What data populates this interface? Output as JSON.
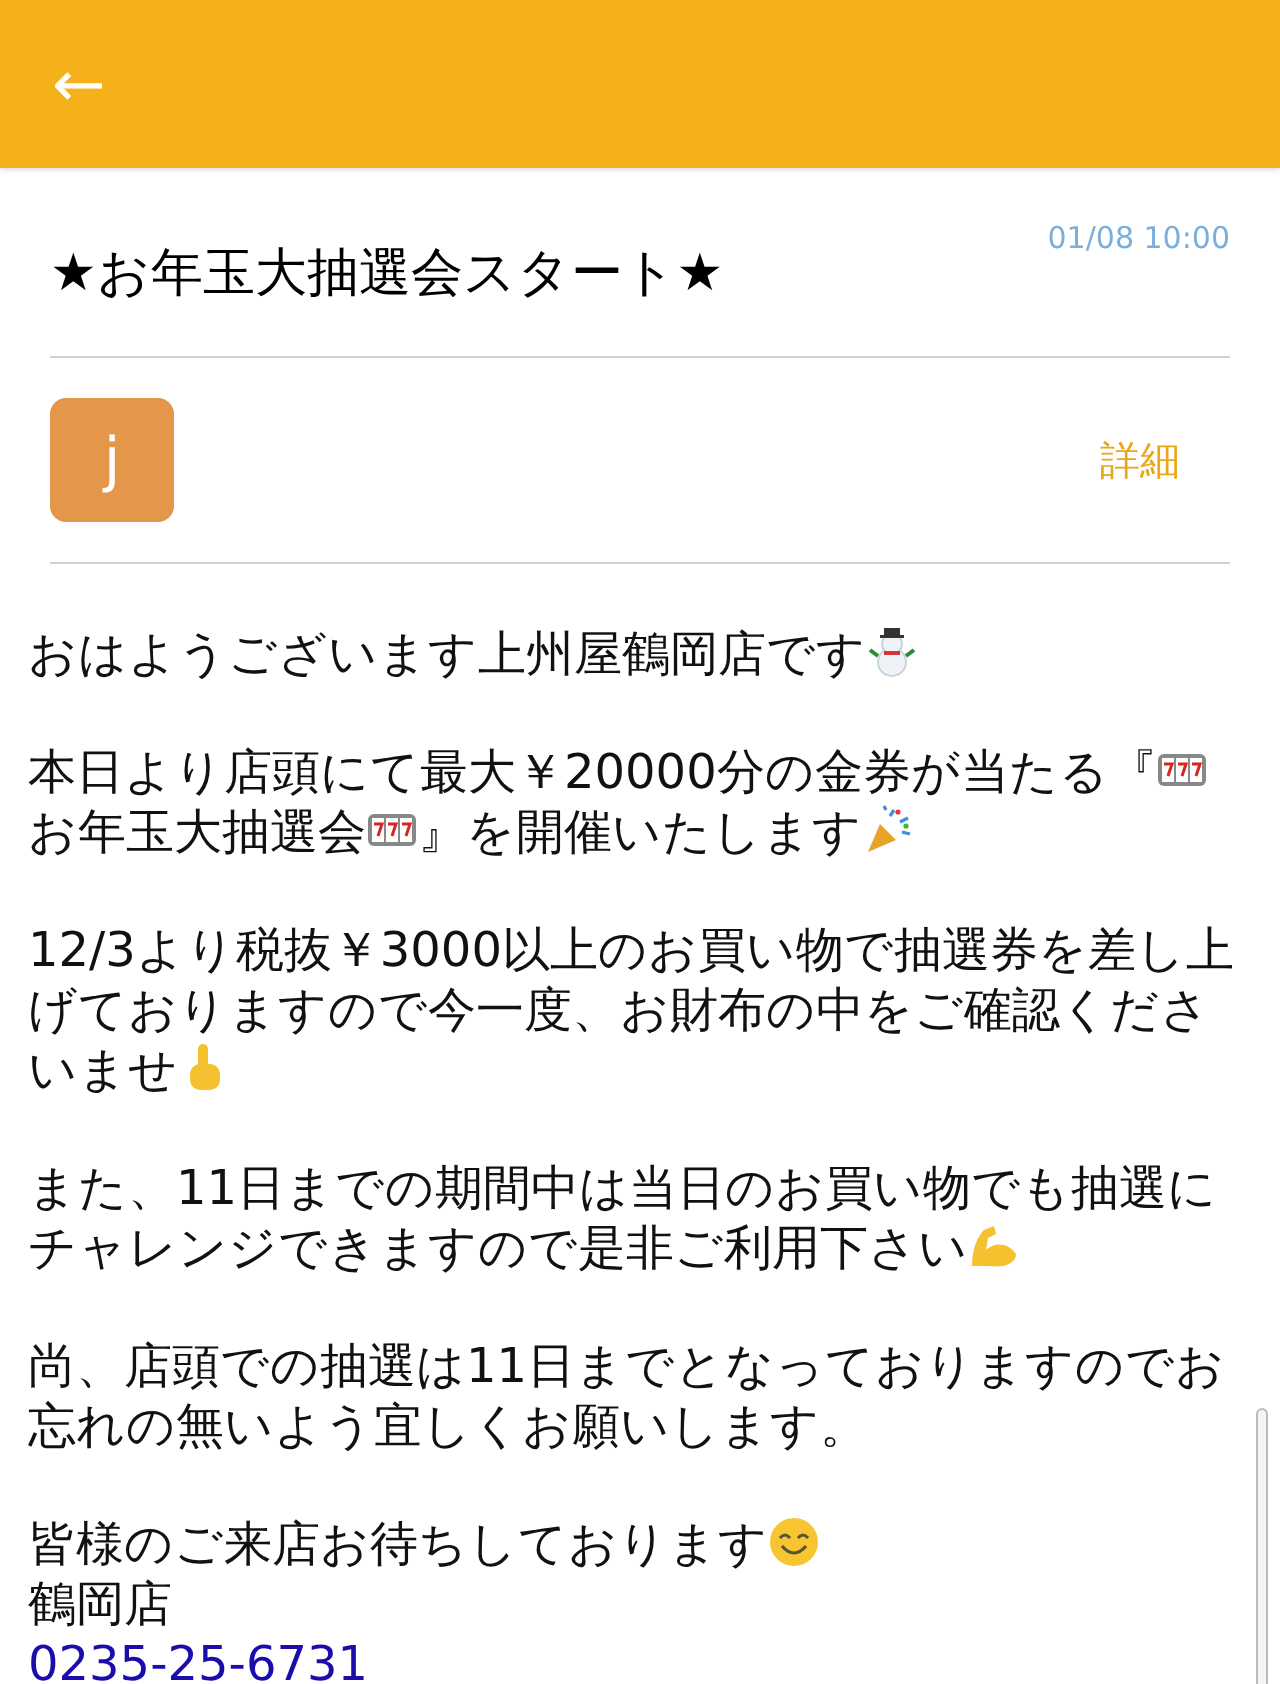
{
  "header": {
    "back": "←"
  },
  "message": {
    "title": "★お年玉大抽選会スタート★",
    "date": "01/08 10:00",
    "avatar": "j",
    "details": "詳細"
  },
  "body": [
    [
      [
        {
          "kind": "text",
          "text": "おはようございます上州屋鶴岡店です"
        },
        {
          "kind": "snowman"
        }
      ]
    ],
    [
      [
        {
          "kind": "text",
          "text": "本日より店頭にて最大￥20000分の金券が当たる『"
        },
        {
          "kind": "slot"
        }
      ],
      [
        {
          "kind": "text",
          "text": "お年玉大抽選会"
        },
        {
          "kind": "slot"
        },
        {
          "kind": "text",
          "text": "』を開催いたします"
        },
        {
          "kind": "popper"
        }
      ]
    ],
    [
      [
        {
          "kind": "text",
          "text": "12/3より税抜￥3000以上のお買い物で抽選券を差し上"
        }
      ],
      [
        {
          "kind": "text",
          "text": "げておりますので今一度、お財布の中をご確認くださ"
        }
      ],
      [
        {
          "kind": "text",
          "text": "いませ"
        },
        {
          "kind": "finger"
        }
      ]
    ],
    [
      [
        {
          "kind": "text",
          "text": "また、11日までの期間中は当日のお買い物でも抽選に"
        }
      ],
      [
        {
          "kind": "text",
          "text": "チャレンジできますので是非ご利用下さい"
        },
        {
          "kind": "arm"
        }
      ]
    ],
    [
      [
        {
          "kind": "text",
          "text": "尚、店頭での抽選は11日までとなっておりますのでお"
        }
      ],
      [
        {
          "kind": "text",
          "text": "忘れの無いよう宜しくお願いします。"
        }
      ]
    ],
    [
      [
        {
          "kind": "text",
          "text": "皆様のご来店お待ちしております"
        },
        {
          "kind": "smile"
        }
      ],
      [
        {
          "kind": "text",
          "text": "鶴岡店"
        }
      ],
      [
        {
          "kind": "link",
          "text": "0235-25-6731"
        }
      ]
    ]
  ]
}
